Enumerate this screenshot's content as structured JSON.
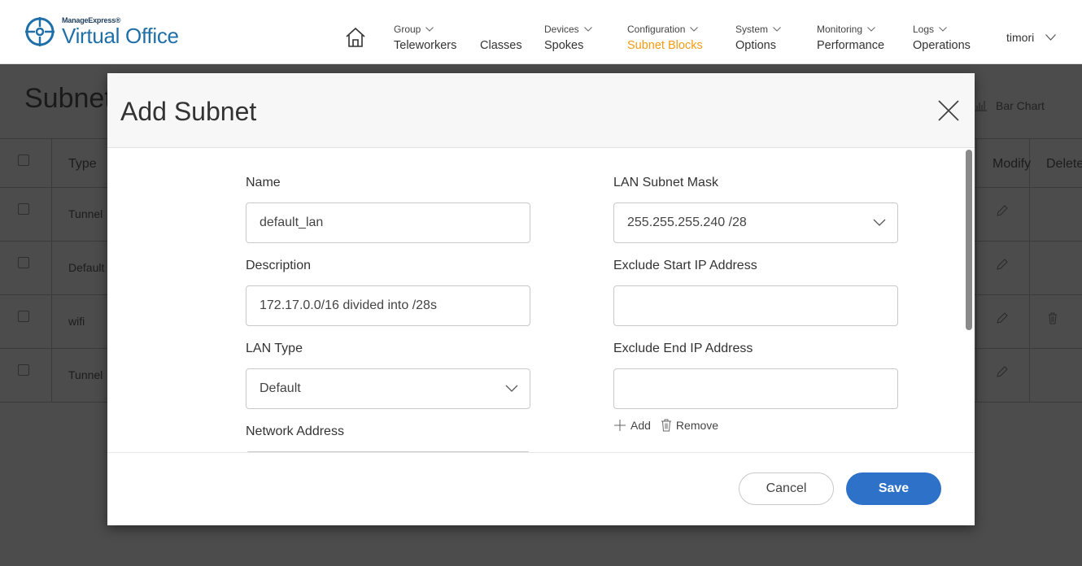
{
  "header": {
    "logo_top": "ManageExpress®",
    "logo_main": "Virtual Office",
    "nav": [
      {
        "top": "Group",
        "main": "Teleworkers",
        "has_chevron": true
      },
      {
        "top": "",
        "main": "Classes",
        "has_chevron": false
      },
      {
        "top": "Devices",
        "main": "Spokes",
        "has_chevron": true
      },
      {
        "top": "Configuration",
        "main": "Subnet Blocks",
        "has_chevron": true,
        "active": true
      },
      {
        "top": "System",
        "main": "Options",
        "has_chevron": true
      },
      {
        "top": "Monitoring",
        "main": "Performance",
        "has_chevron": true
      },
      {
        "top": "Logs",
        "main": "Operations",
        "has_chevron": true
      }
    ],
    "user": "timori",
    "colors": {
      "active_nav": "#f39c12",
      "brand": "#1f6fa8"
    }
  },
  "background_page": {
    "title": "Subnet",
    "bar_chart_label": "Bar Chart",
    "table": {
      "headers": {
        "type": "Type",
        "modify": "Modify",
        "delete": "Delete"
      },
      "rows": [
        {
          "type": "Tunnel",
          "deletable": false
        },
        {
          "type": "Default",
          "deletable": false
        },
        {
          "type": "wifi",
          "deletable": true
        },
        {
          "type": "Tunnel",
          "deletable": false
        }
      ]
    }
  },
  "modal": {
    "title": "Add Subnet",
    "fields": {
      "name_label": "Name",
      "name_value": "default_lan",
      "description_label": "Description",
      "description_value": "172.17.0.0/16 divided into /28s",
      "lan_type_label": "LAN Type",
      "lan_type_value": "Default",
      "network_address_label": "Network Address",
      "lan_subnet_mask_label": "LAN Subnet Mask",
      "lan_subnet_mask_value": "255.255.255.240 /28",
      "exclude_start_label": "Exclude Start IP Address",
      "exclude_start_value": "",
      "exclude_end_label": "Exclude End IP Address",
      "exclude_end_value": ""
    },
    "add_label": "Add",
    "remove_label": "Remove",
    "cancel_label": "Cancel",
    "save_label": "Save",
    "colors": {
      "save": "#2d72c8"
    }
  }
}
